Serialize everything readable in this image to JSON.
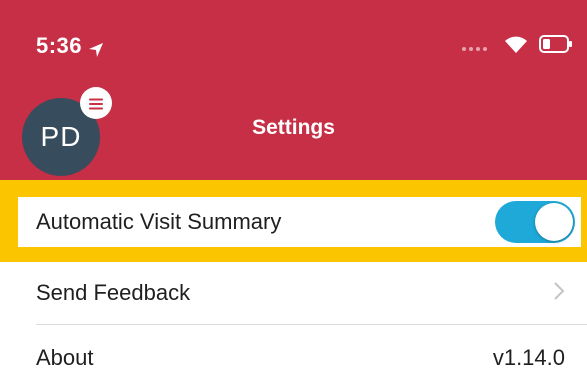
{
  "status_bar": {
    "time": "5:36"
  },
  "header": {
    "title": "Settings",
    "avatar_initials": "PD"
  },
  "settings": {
    "items": [
      {
        "label": "Automatic Visit Summary",
        "toggle_on": true
      },
      {
        "label": "Send Feedback"
      },
      {
        "label": "About",
        "value": "v1.14.0"
      }
    ]
  },
  "colors": {
    "header_bg": "#c62f45",
    "highlight": "#fbc500",
    "toggle_on": "#1fa9d8",
    "avatar_bg": "#374c5c"
  },
  "icons": [
    "location-arrow-icon",
    "signal-dots-icon",
    "wifi-icon",
    "battery-icon",
    "menu-icon",
    "chevron-right-icon"
  ]
}
